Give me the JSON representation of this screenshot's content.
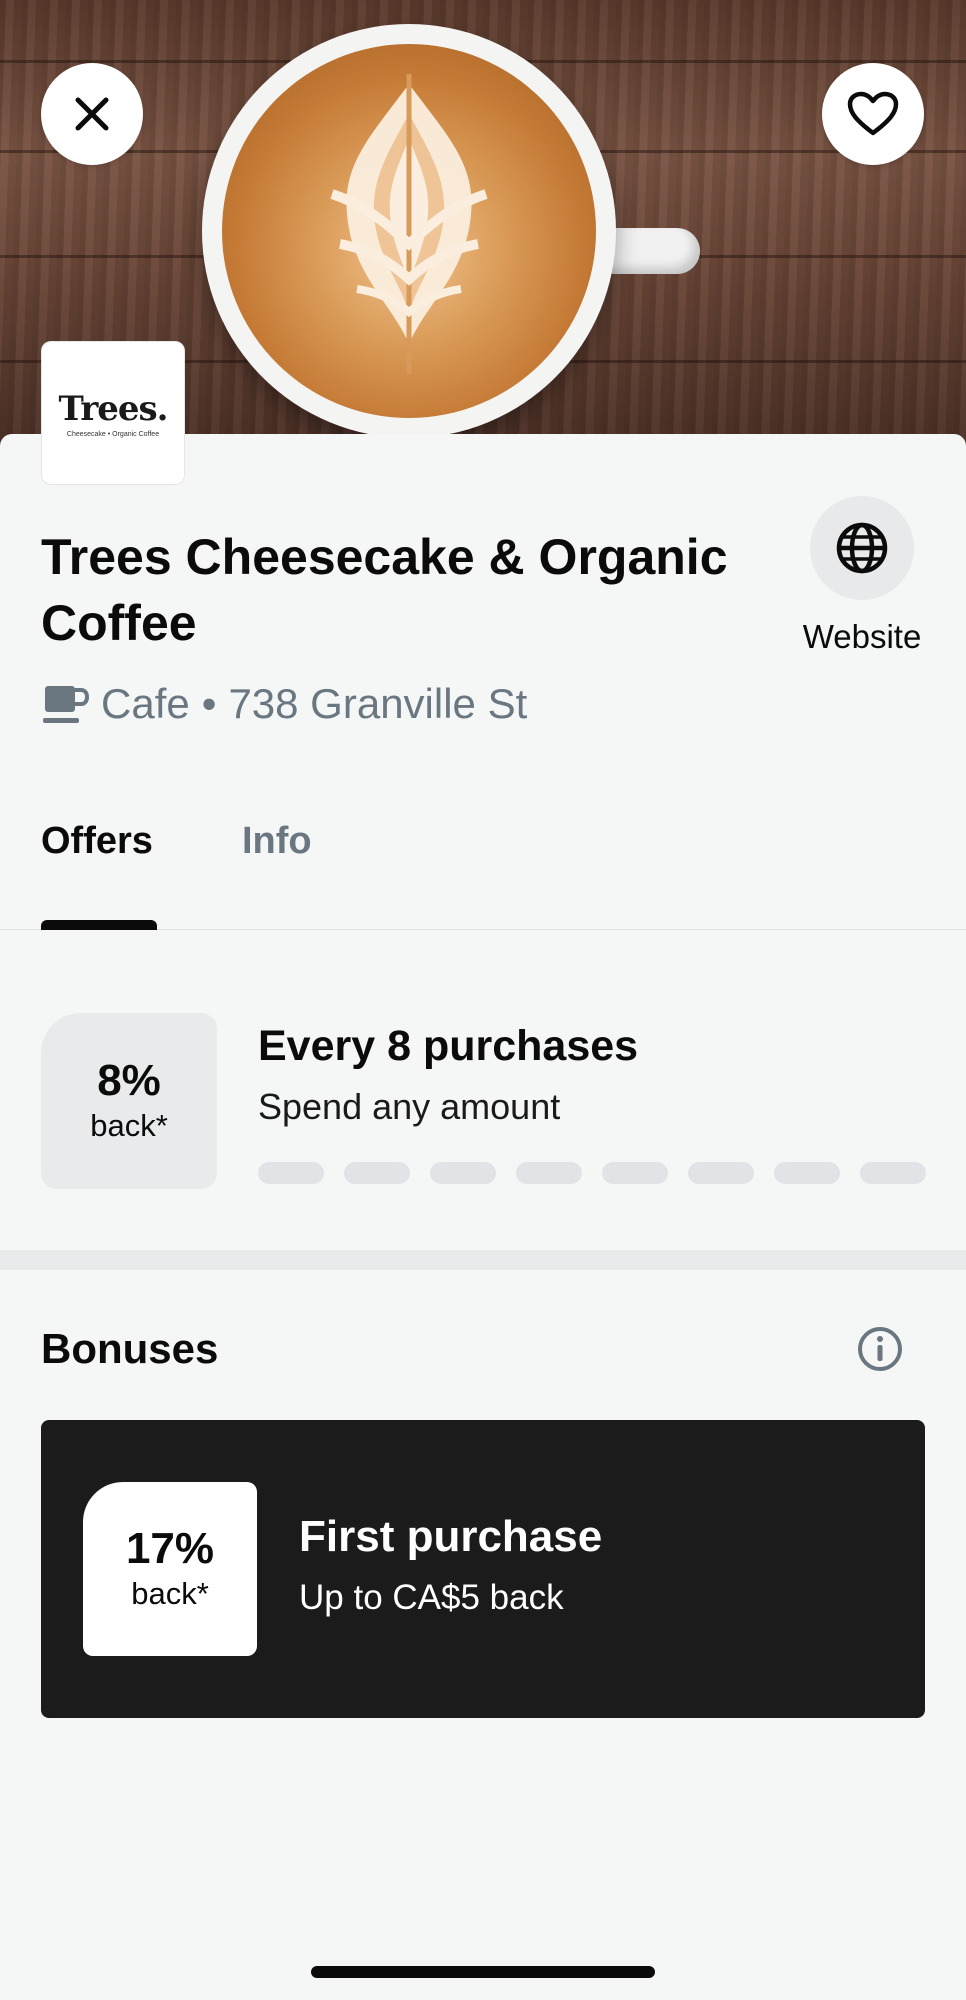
{
  "header": {
    "close_icon": "close-icon",
    "favorite_icon": "heart-outline-icon"
  },
  "merchant": {
    "logo_text": "Trees.",
    "logo_subtext": "Cheesecake • Organic Coffee",
    "name": "Trees Cheesecake & Organic Coffee",
    "category": "Cafe",
    "separator": "•",
    "address": "738 Granville St",
    "website_label": "Website"
  },
  "tabs": [
    {
      "label": "Offers",
      "active": true
    },
    {
      "label": "Info",
      "active": false
    }
  ],
  "offer": {
    "percent": "8%",
    "back": "back*",
    "title": "Every 8 purchases",
    "subtitle": "Spend any amount",
    "progress_completed": 0,
    "progress_total": 8
  },
  "bonuses": {
    "title": "Bonuses",
    "items": [
      {
        "percent": "17%",
        "back": "back*",
        "title": "First purchase",
        "subtitle": "Up to CA$5 back"
      }
    ]
  },
  "colors": {
    "background": "#f5f7f7",
    "text": "#0b0b0b",
    "muted": "#6a7680",
    "card_dark": "#1b1b1b",
    "progress_empty": "#e1e4e7"
  }
}
